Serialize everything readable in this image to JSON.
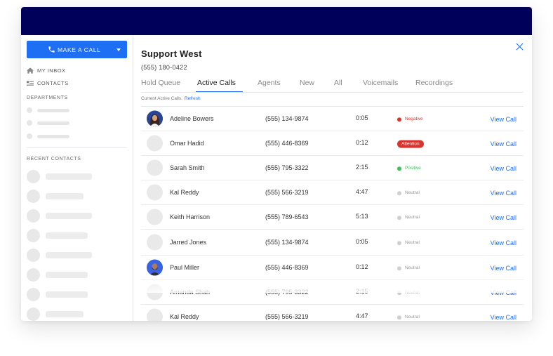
{
  "sidebar": {
    "make_call_label": "MAKE A CALL",
    "nav": [
      {
        "label": "MY INBOX",
        "icon": "home-icon"
      },
      {
        "label": "CONTACTS",
        "icon": "contacts-icon"
      }
    ],
    "departments_title": "DEPARTMENTS",
    "recent_contacts_title": "RECENT CONTACTS"
  },
  "header": {
    "title": "Support West",
    "phone": "(555) 180-0422"
  },
  "tabs": [
    {
      "label": "Hold Queue",
      "active": false
    },
    {
      "label": "Active Calls",
      "active": true
    },
    {
      "label": "Agents",
      "active": false
    },
    {
      "label": "New",
      "active": false
    },
    {
      "label": "All",
      "active": false
    },
    {
      "label": "Voicemails",
      "active": false
    },
    {
      "label": "Recordings",
      "active": false
    }
  ],
  "meta": {
    "text": "Current Active Calls.",
    "refresh": "Refresh"
  },
  "status_colors": {
    "Negative": "#d9352e",
    "Attention": "#d9352e",
    "Positive": "#3fbf5a",
    "Neutral": "#cfcfcf"
  },
  "calls": [
    {
      "name": "Adeline Bowers",
      "phone": "(555) 134-9874",
      "duration": "0:05",
      "status": "Negative",
      "action": "View Call",
      "avatar": "photo-woman"
    },
    {
      "name": "Omar Hadid",
      "phone": "(555) 446-8369",
      "duration": "0:12",
      "status": "Attention",
      "action": "View Call",
      "avatar": "placeholder"
    },
    {
      "name": "Sarah Smith",
      "phone": "(555) 795-3322",
      "duration": "2:15",
      "status": "Positive",
      "action": "View Call",
      "avatar": "placeholder"
    },
    {
      "name": "Kal Reddy",
      "phone": "(555) 566-3219",
      "duration": "4:47",
      "status": "Neutral",
      "action": "View Call",
      "avatar": "placeholder"
    },
    {
      "name": "Keith Harrison",
      "phone": "(555) 789-6543",
      "duration": "5:13",
      "status": "Neutral",
      "action": "View Call",
      "avatar": "placeholder"
    },
    {
      "name": "Jarred Jones",
      "phone": "(555) 134-9874",
      "duration": "0:05",
      "status": "Neutral",
      "action": "View Call",
      "avatar": "placeholder"
    },
    {
      "name": "Paul Miller",
      "phone": "(555) 446-8369",
      "duration": "0:12",
      "status": "Neutral",
      "action": "View Call",
      "avatar": "photo-man"
    },
    {
      "name": "Amanda Shah",
      "phone": "(555) 795-3322",
      "duration": "2:15",
      "status": "Neutral",
      "action": "View Call",
      "avatar": "placeholder"
    },
    {
      "name": "Kal Reddy",
      "phone": "(555) 566-3219",
      "duration": "4:47",
      "status": "Neutral",
      "action": "View Call",
      "avatar": "placeholder"
    }
  ]
}
